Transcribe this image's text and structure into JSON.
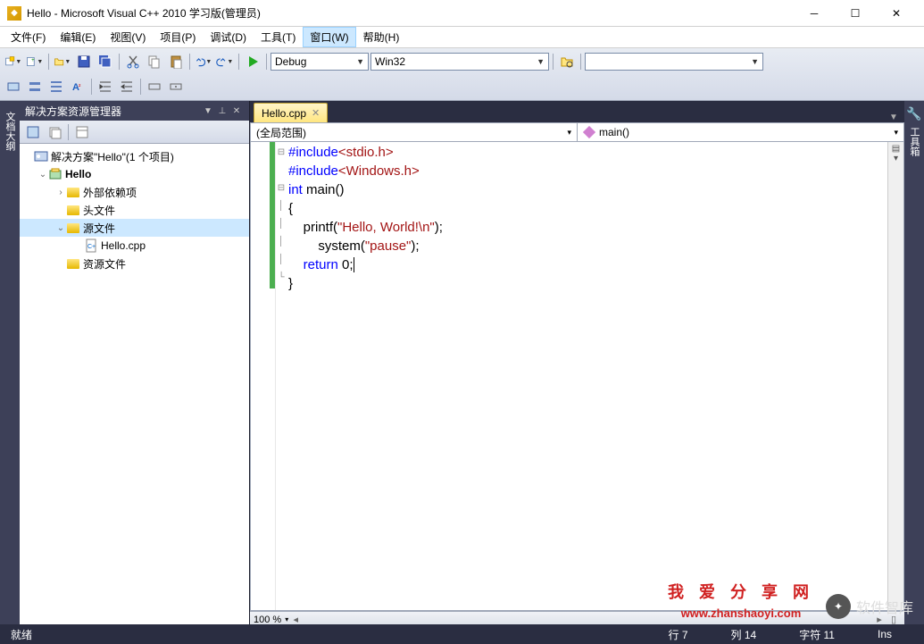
{
  "window": {
    "title": "Hello - Microsoft Visual C++ 2010 学习版(管理员)"
  },
  "menu": {
    "items": [
      "文件(F)",
      "编辑(E)",
      "视图(V)",
      "项目(P)",
      "调试(D)",
      "工具(T)",
      "窗口(W)",
      "帮助(H)"
    ],
    "active_index": 6
  },
  "toolbar": {
    "config_combo": "Debug",
    "platform_combo": "Win32"
  },
  "solution_explorer": {
    "title": "解决方案资源管理器",
    "root": "解决方案\"Hello\"(1 个项目)",
    "project": "Hello",
    "folders": {
      "external": "外部依赖项",
      "headers": "头文件",
      "sources": "源文件",
      "resources": "资源文件"
    },
    "files": {
      "hello_cpp": "Hello.cpp"
    }
  },
  "left_tab": {
    "label": "文档大纲"
  },
  "right_tab": {
    "label": "工具箱"
  },
  "editor": {
    "tab_name": "Hello.cpp",
    "scope_combo": "(全局范围)",
    "member_combo": "main()",
    "zoom": "100 %",
    "code": {
      "l1a": "#include",
      "l1b": "<stdio.h>",
      "l2a": "#include",
      "l2b": "<Windows.h>",
      "l3a": "int",
      "l3b": " main()",
      "l4": "{",
      "l5a": "    printf(",
      "l5b": "\"Hello, World!\\n\"",
      "l5c": ");",
      "l6a": "        system(",
      "l6b": "\"pause\"",
      "l6c": ");",
      "l7a": "    ",
      "l7b": "return",
      "l7c": " 0;",
      "l8": "}"
    }
  },
  "watermark": {
    "line1": "我 爱 分 享 网",
    "line2": "www.zhanshaoyi.com"
  },
  "badge": {
    "text": "软件智库"
  },
  "status": {
    "ready": "就绪",
    "line": "行 7",
    "col": "列 14",
    "char": "字符 11",
    "ins": "Ins"
  }
}
